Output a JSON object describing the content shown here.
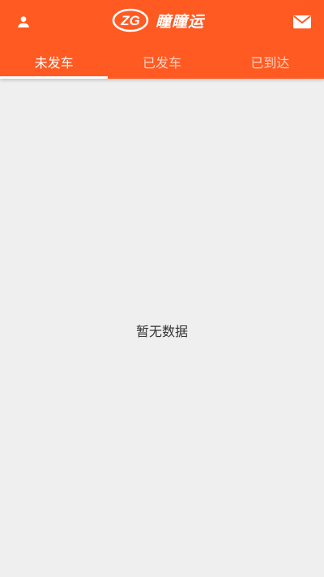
{
  "header": {
    "logo_text": "瞳瞳运",
    "user_icon": "user-icon",
    "mail_icon": "mail-icon",
    "brand_color": "#ff5a22"
  },
  "tabs": [
    {
      "label": "未发车",
      "active": true
    },
    {
      "label": "已发车",
      "active": false
    },
    {
      "label": "已到达",
      "active": false
    }
  ],
  "main": {
    "empty_text": "暂无数据"
  }
}
